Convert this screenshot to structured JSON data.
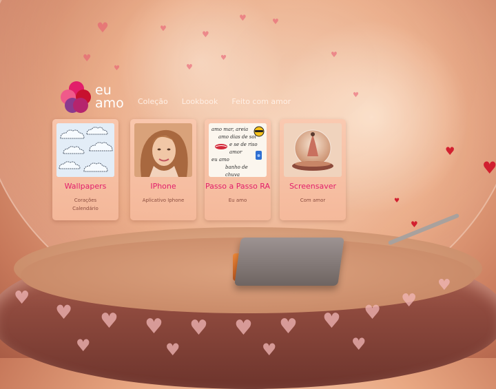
{
  "brand": {
    "logo_line1": "eu",
    "logo_line2": "amo",
    "colors": {
      "pink": "#e21e6a",
      "red": "#c8102e",
      "purple": "#8a3a8e",
      "orange": "#f08a3a"
    }
  },
  "nav": {
    "items": [
      {
        "label": "Coleção"
      },
      {
        "label": "Lookbook"
      },
      {
        "label": "Feito com amor"
      }
    ]
  },
  "cards": [
    {
      "title": "Wallpapers",
      "lines": [
        "Corações",
        "Calendário"
      ],
      "thumb_icon": "clouds-pattern"
    },
    {
      "title": "IPhone",
      "lines": [
        "Aplicativo Iphone"
      ],
      "thumb_icon": "woman-portrait"
    },
    {
      "title": "Passo a Passo RA",
      "lines": [
        "Eu amo"
      ],
      "thumb_icon": "handwritten-note"
    },
    {
      "title": "Screensaver",
      "lines": [
        "Com amor"
      ],
      "thumb_icon": "snow-globe"
    }
  ],
  "note_text": [
    "amo mar, areia",
    "amo dias de sol",
    "e se de riso",
    "amor",
    "eu amo",
    "banho de chuva"
  ]
}
